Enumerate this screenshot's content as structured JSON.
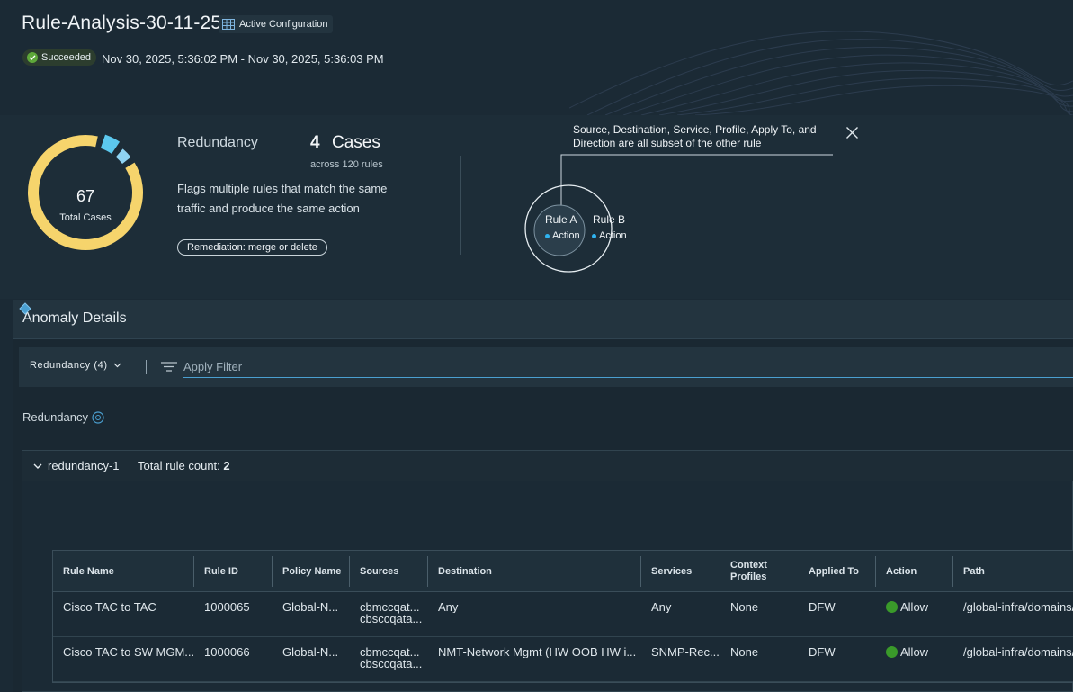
{
  "header": {
    "title": "Rule-Analysis-30-11-25",
    "config_badge": "Active Configuration",
    "status": "Succeeded",
    "time_range": "Nov 30, 2025, 5:36:02 PM - Nov 30, 2025, 5:36:03 PM"
  },
  "summary": {
    "total_cases": "67",
    "total_cases_label": "Total Cases",
    "category": "Redundancy",
    "cases_count": "4",
    "cases_word": "Cases",
    "cases_sub": "across 120 rules",
    "description": "Flags multiple rules that match the same traffic and produce the same action",
    "remediation": "Remediation: merge or delete",
    "callout": "Source, Destination, Service, Profile, Apply To, and Direction are all subset of the other rule",
    "rule_a": "Rule A",
    "rule_b": "Rule B",
    "action": "Action",
    "donut_segments": [
      {
        "name": "Redundancy",
        "fraction": 0.06,
        "color": "#5cc8ee"
      },
      {
        "name": "Other",
        "fraction": 0.05,
        "color": "#8fd3f2"
      },
      {
        "name": "Remaining",
        "fraction": 0.89,
        "color": "#f6d46c"
      }
    ]
  },
  "details": {
    "title": "Anomaly Details",
    "filter_select": "Redundancy (4)",
    "filter_placeholder": "Apply Filter",
    "group_label": "Redundancy",
    "group_name": "redundancy-1",
    "group_count_label": "Total rule count:",
    "group_count": "2",
    "columns": [
      "Rule Name",
      "Rule ID",
      "Policy Name",
      "Sources",
      "Destination",
      "Services",
      "Context Profiles",
      "Applied To",
      "Action",
      "Path"
    ],
    "rows": [
      {
        "rule_name": "Cisco TAC to TAC",
        "rule_id": "1000065",
        "policy_name": "Global-N...",
        "sources_1": "cbmccqat...",
        "sources_2": "cbsccqata...",
        "destination": "Any",
        "services": "Any",
        "context_profiles": "None",
        "applied_to": "DFW",
        "action": "Allow",
        "path": "/global-infra/domains/"
      },
      {
        "rule_name": "Cisco TAC to SW MGM...",
        "rule_id": "1000066",
        "policy_name": "Global-N...",
        "sources_1": "cbmccqat...",
        "sources_2": "cbsccqata...",
        "destination": "NMT-Network Mgmt (HW OOB HW i...",
        "services": "SNMP-Rec...",
        "context_profiles": "None",
        "applied_to": "DFW",
        "action": "Allow",
        "path": "/global-infra/domains/"
      }
    ]
  }
}
